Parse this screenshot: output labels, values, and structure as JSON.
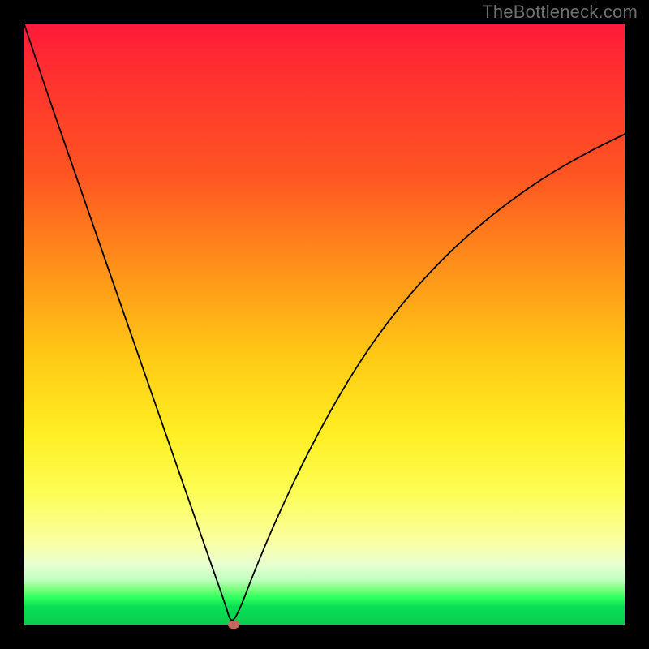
{
  "watermark": "TheBottleneck.com",
  "colors": {
    "frame": "#000000",
    "gradient_top": "#ff1a3a",
    "gradient_mid": "#ffee22",
    "gradient_bottom": "#0acd4d",
    "curve": "#000000",
    "marker": "#c66560",
    "watermark": "#707070"
  },
  "chart_data": {
    "type": "line",
    "title": "",
    "xlabel": "",
    "ylabel": "",
    "xlim": [
      0,
      100
    ],
    "ylim": [
      0,
      100
    ],
    "x": [
      0,
      4,
      8,
      12,
      16,
      20,
      24,
      28,
      30,
      32,
      33.5,
      34.5,
      36,
      38,
      42,
      48,
      55,
      62,
      70,
      78,
      86,
      94,
      100
    ],
    "values": [
      100,
      88,
      76.5,
      65,
      53.5,
      42,
      30.5,
      19,
      13.3,
      7.6,
      3.3,
      0,
      2.8,
      8.1,
      17.7,
      30.3,
      42.6,
      52.5,
      61.4,
      68.4,
      74.2,
      78.8,
      81.7
    ],
    "vertex_x": 34.5,
    "marker": {
      "x": 34.8,
      "y": 0
    },
    "annotations": []
  }
}
